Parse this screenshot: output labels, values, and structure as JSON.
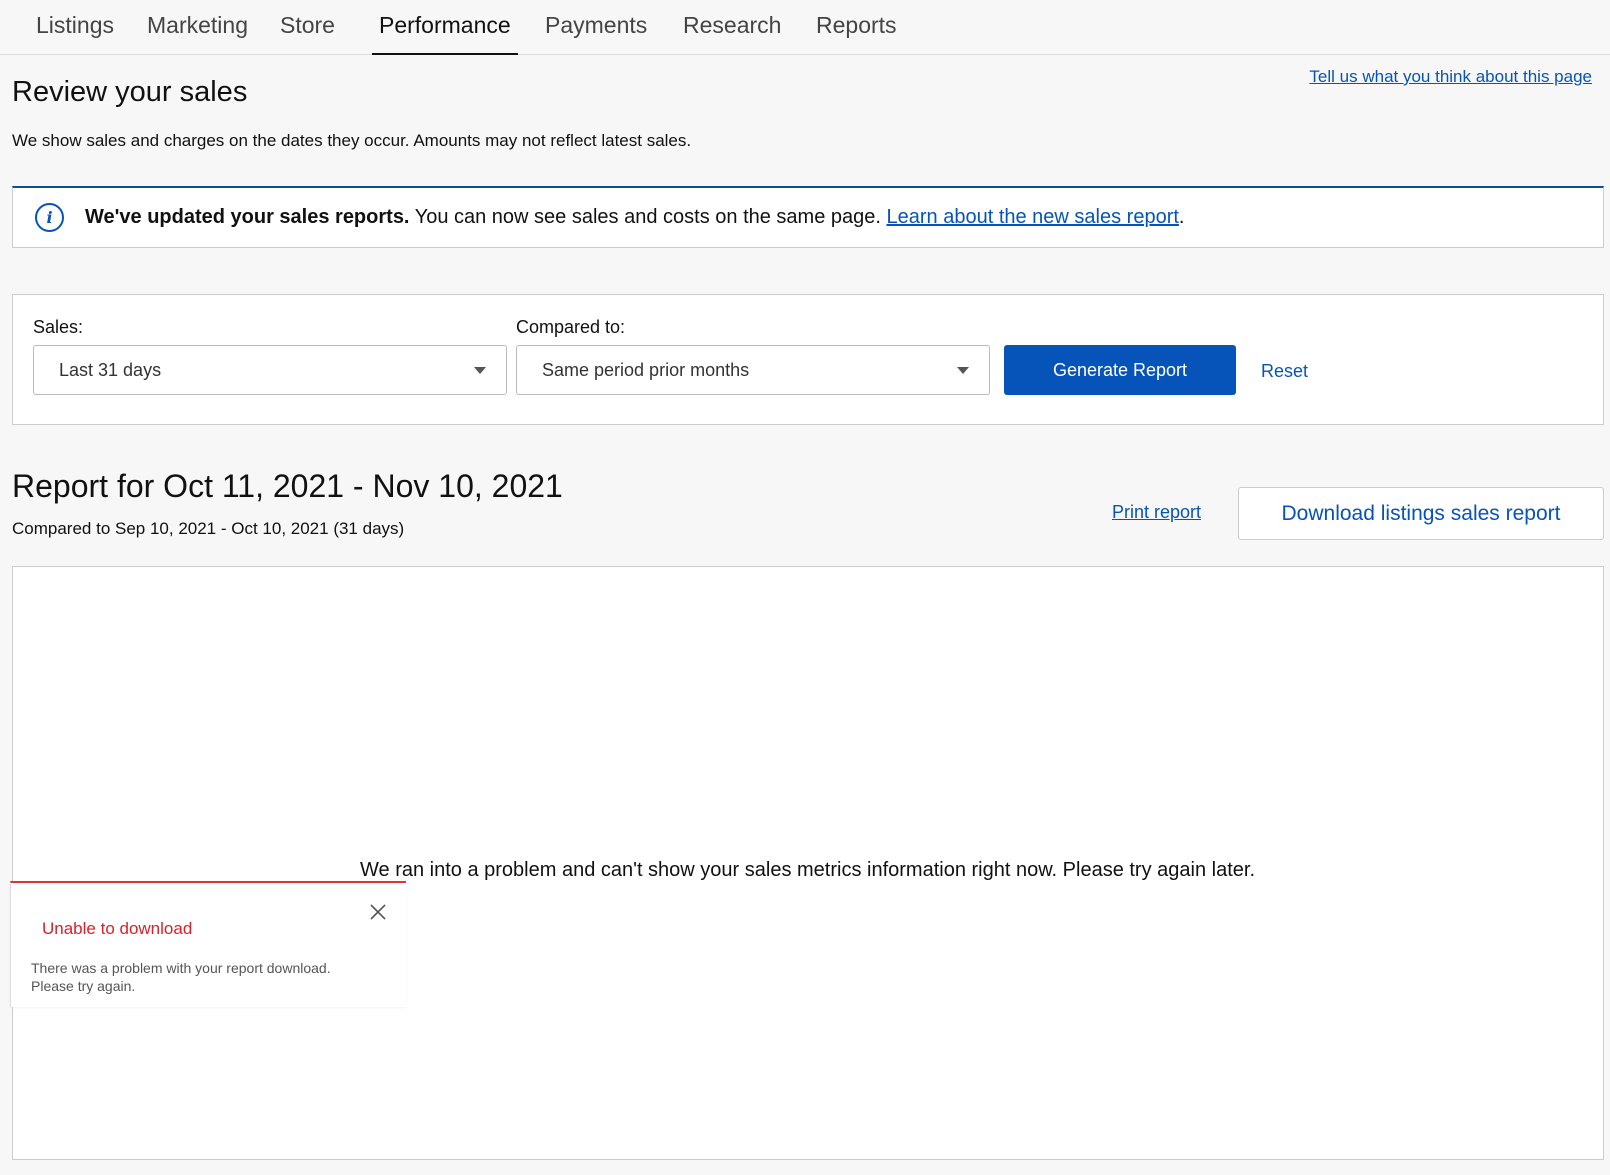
{
  "nav": {
    "tabs": [
      {
        "label": "Listings"
      },
      {
        "label": "Marketing"
      },
      {
        "label": "Store"
      },
      {
        "label": "Performance",
        "active": true
      },
      {
        "label": "Payments"
      },
      {
        "label": "Research"
      },
      {
        "label": "Reports"
      }
    ]
  },
  "header": {
    "title": "Review your sales",
    "feedback_link": "Tell us what you think about this page",
    "subtitle": "We show sales and charges on the dates they occur. Amounts may not reflect latest sales."
  },
  "banner": {
    "icon": "info-icon",
    "bold_text": "We've updated your sales reports.",
    "text": " You can now see sales and costs on the same page. ",
    "link": "Learn about the new sales report",
    "trailing": "."
  },
  "filters": {
    "sales_label": "Sales:",
    "sales_value": "Last 31 days",
    "compared_label": "Compared to:",
    "compared_value": "Same period prior months",
    "generate_label": "Generate Report",
    "reset_label": "Reset"
  },
  "report": {
    "title": "Report for Oct 11, 2021 - Nov 10, 2021",
    "compared": "Compared to Sep 10, 2021 - Oct 10, 2021 (31 days)",
    "print_label": "Print report",
    "download_label": "Download listings sales report",
    "error_message": "We ran into a problem and can't show your sales metrics information right now. Please try again later."
  },
  "toast": {
    "title": "Unable to download",
    "body_line1": "There was a problem with your report download.",
    "body_line2": "Please try again.",
    "close_icon": "close-icon"
  },
  "colors": {
    "accent": "#0654ba",
    "error": "#d9202a"
  }
}
